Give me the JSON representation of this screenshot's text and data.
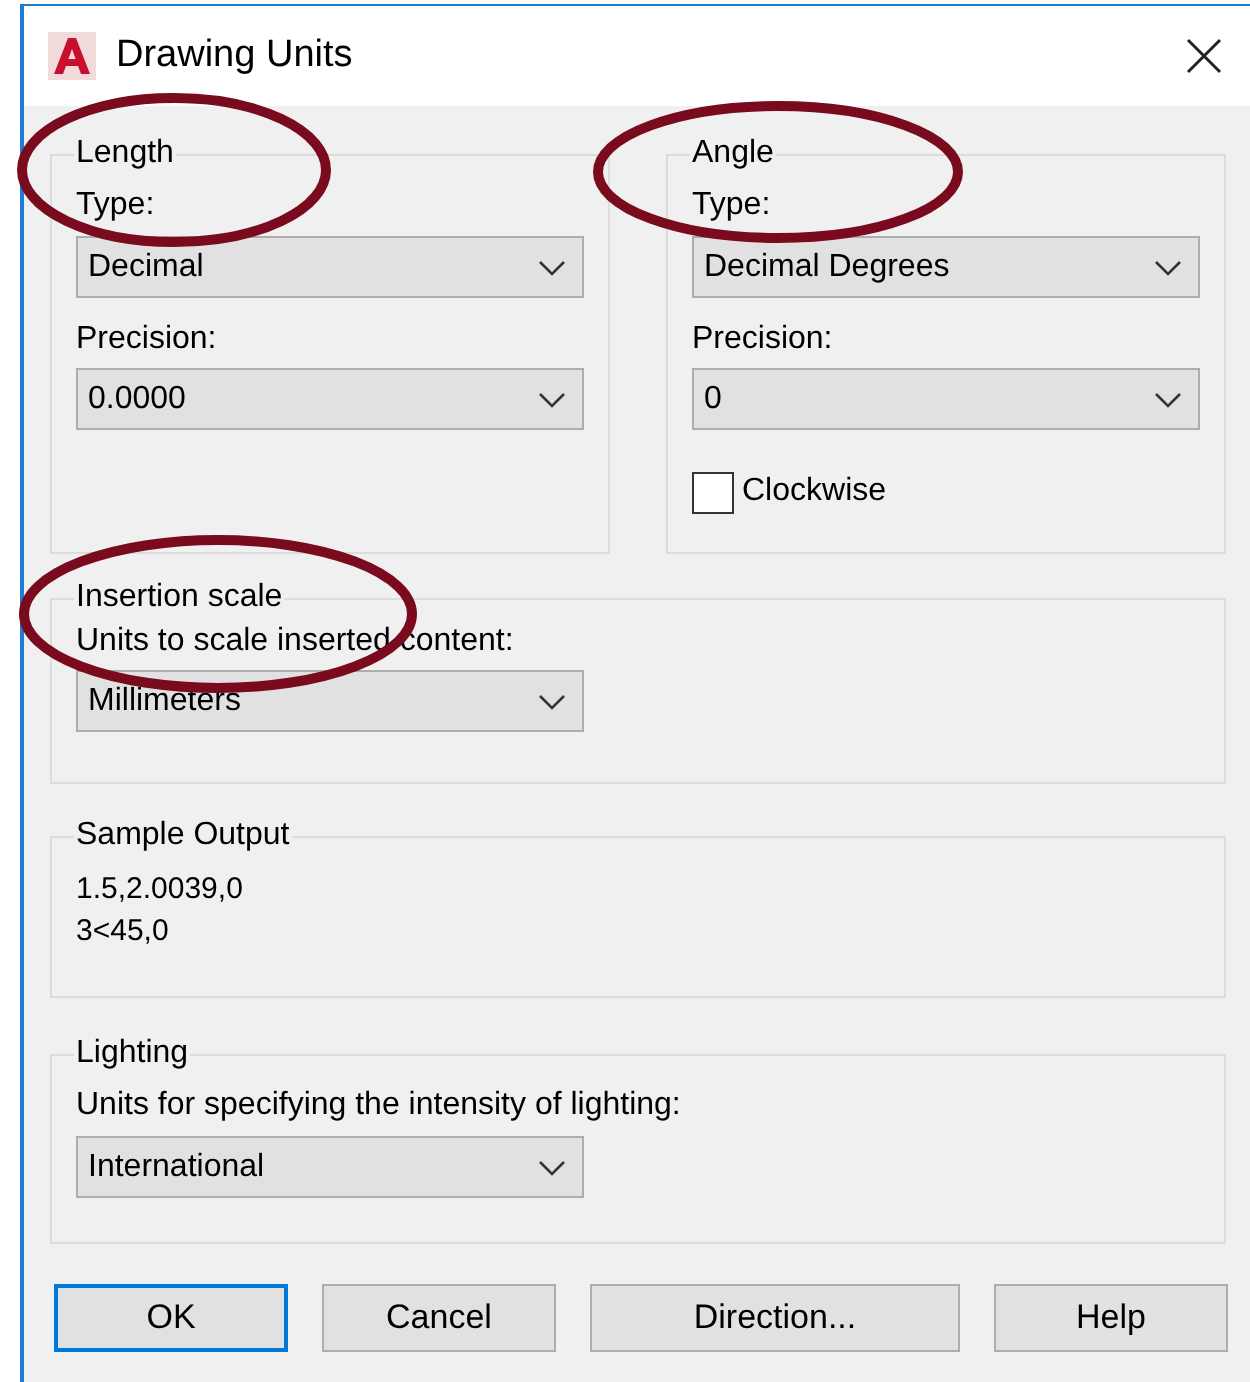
{
  "window": {
    "title": "Drawing Units"
  },
  "length": {
    "legend": "Length",
    "type_label": "Type:",
    "type_value": "Decimal",
    "precision_label": "Precision:",
    "precision_value": "0.0000"
  },
  "angle": {
    "legend": "Angle",
    "type_label": "Type:",
    "type_value": "Decimal Degrees",
    "precision_label": "Precision:",
    "precision_value": "0",
    "clockwise": {
      "label": "Clockwise",
      "checked": false
    }
  },
  "insertion_scale": {
    "legend": "Insertion scale",
    "label": "Units to scale inserted content:",
    "value": "Millimeters"
  },
  "sample_output": {
    "legend": "Sample Output",
    "lines": [
      "1.5,2.0039,0",
      "3<45,0"
    ]
  },
  "lighting": {
    "legend": "Lighting",
    "label": "Units for specifying the intensity of lighting:",
    "value": "International"
  },
  "buttons": [
    {
      "label": "OK",
      "default": true
    },
    {
      "label": "Cancel",
      "default": false
    },
    {
      "label": "Direction...",
      "default": false
    },
    {
      "label": "Help",
      "default": false
    }
  ]
}
